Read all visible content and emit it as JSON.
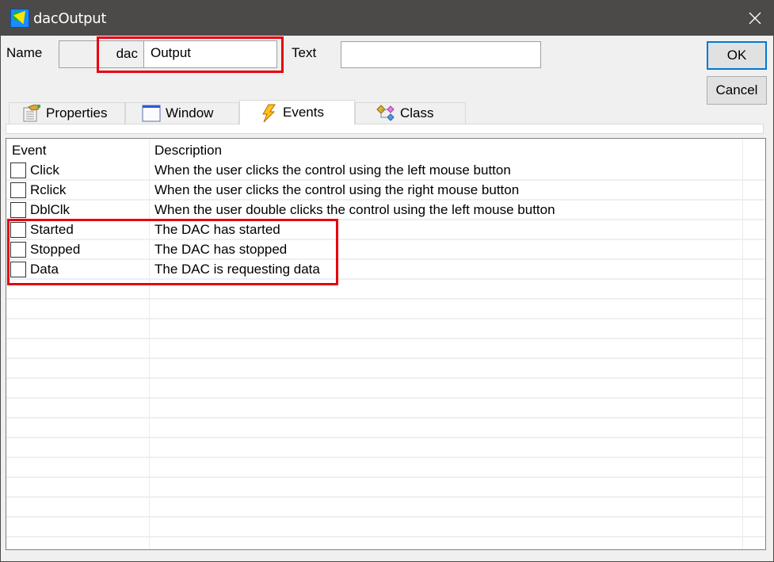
{
  "window": {
    "title": "dacOutput",
    "app_icon": "app-shape-icon",
    "close_icon": "close-icon"
  },
  "form": {
    "name_label": "Name",
    "name_prefix": "dac",
    "name_value": "Output",
    "text_label": "Text",
    "text_value": "",
    "ok_label": "OK",
    "cancel_label": "Cancel"
  },
  "tabs": [
    {
      "label": "Properties",
      "icon": "properties-icon",
      "active": false
    },
    {
      "label": "Window",
      "icon": "window-icon",
      "active": false
    },
    {
      "label": "Events",
      "icon": "lightning-icon",
      "active": true
    },
    {
      "label": "Class",
      "icon": "class-hierarchy-icon",
      "active": false
    }
  ],
  "grid": {
    "columns": [
      "Event",
      "Description"
    ],
    "rows": [
      {
        "event": "Click",
        "description": "When the user clicks the control using the left mouse button",
        "checked": false
      },
      {
        "event": "Rclick",
        "description": "When the user clicks the control using the right mouse button",
        "checked": false
      },
      {
        "event": "DblClk",
        "description": "When the user double clicks the control using the left mouse button",
        "checked": false
      },
      {
        "event": "Started",
        "description": "The DAC has started",
        "checked": false
      },
      {
        "event": "Stopped",
        "description": "The DAC has stopped",
        "checked": false
      },
      {
        "event": "Data",
        "description": "The DAC is requesting data",
        "checked": false
      }
    ],
    "empty_row_count": 13
  },
  "colors": {
    "titlebar": "#4c4a48",
    "highlight": "#e8000b",
    "focus_border": "#0078d7"
  }
}
